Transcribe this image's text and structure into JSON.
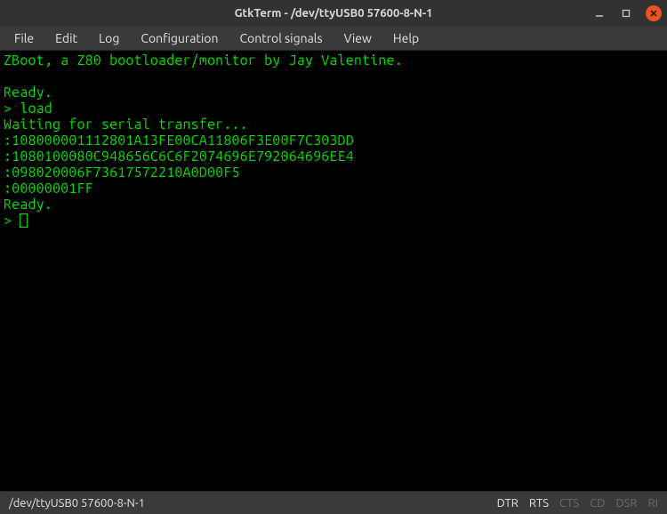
{
  "window": {
    "title": "GtkTerm - /dev/ttyUSB0  57600-8-N-1"
  },
  "menu": {
    "file": "File",
    "edit": "Edit",
    "log": "Log",
    "configuration": "Configuration",
    "control_signals": "Control signals",
    "view": "View",
    "help": "Help"
  },
  "terminal": {
    "lines": [
      "ZBoot, a Z80 bootloader/monitor by Jay Valentine.",
      "",
      "Ready.",
      "> load",
      "Waiting for serial transfer...",
      ":108000001112801A13FE00CA11806F3E00F7C303DD",
      ":1080100080C948656C6C6F2074696E792064696EE4",
      ":098020006F73617572210A0D00F5",
      ":00000001FF",
      "Ready.",
      "> "
    ]
  },
  "status": {
    "left": "/dev/ttyUSB0  57600-8-N-1",
    "signals": {
      "dtr": {
        "label": "DTR",
        "active": true
      },
      "rts": {
        "label": "RTS",
        "active": true
      },
      "cts": {
        "label": "CTS",
        "active": false
      },
      "cd": {
        "label": "CD",
        "active": false
      },
      "dsr": {
        "label": "DSR",
        "active": false
      },
      "ri": {
        "label": "RI",
        "active": false
      }
    }
  }
}
